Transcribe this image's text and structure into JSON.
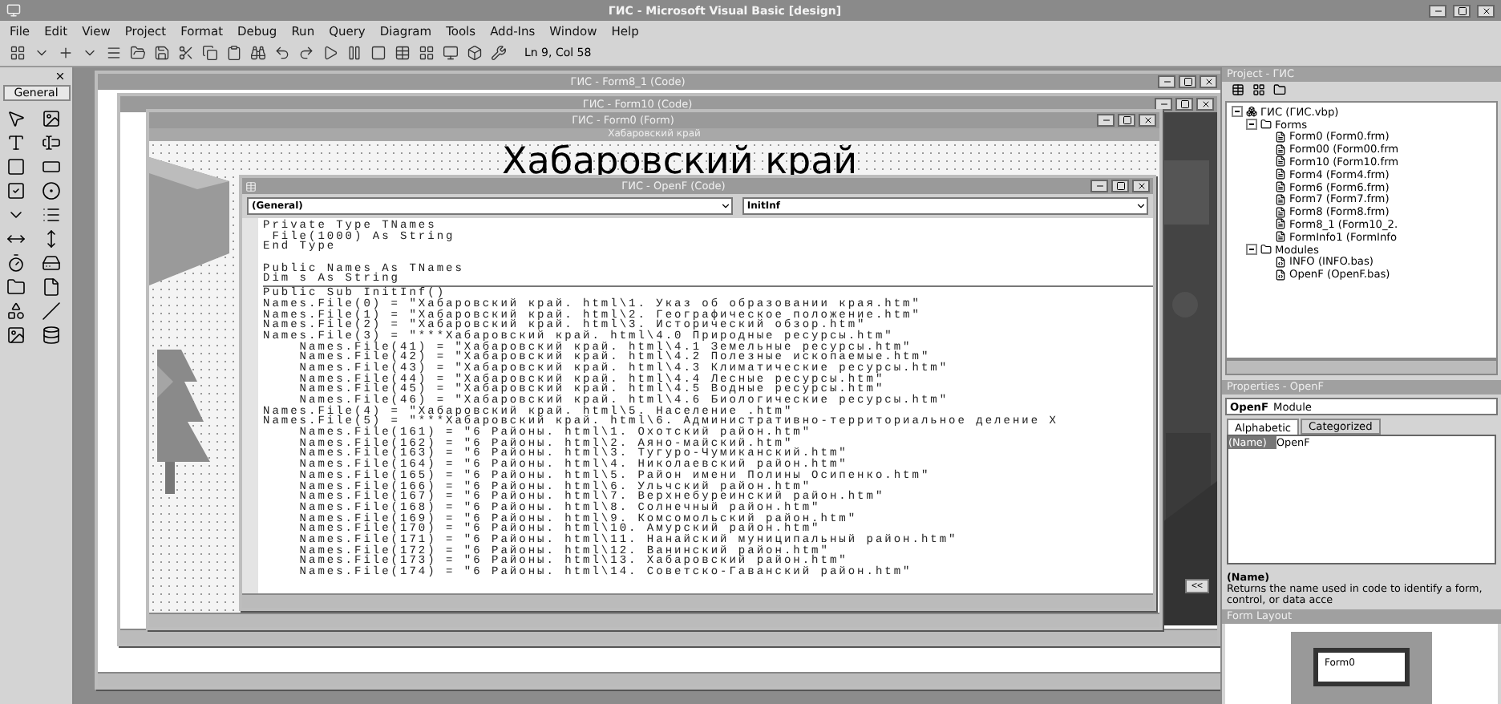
{
  "window": {
    "title": "ГИС - Microsoft Visual Basic [design]"
  },
  "menu": [
    "File",
    "Edit",
    "View",
    "Project",
    "Format",
    "Debug",
    "Run",
    "Query",
    "Diagram",
    "Tools",
    "Add-Ins",
    "Window",
    "Help"
  ],
  "cursor_position": "Ln 9, Col 58",
  "toolbox": {
    "tab": "General"
  },
  "mdi_windows": [
    {
      "title": "ГИС - Form8_1 (Code)"
    },
    {
      "title": "ГИС - Form10 (Code)"
    },
    {
      "title": "ГИС - Form0 (Form)",
      "form_caption": "Хабаровский край",
      "heading": "Хабаровский край"
    }
  ],
  "back_button": "<<",
  "code_window": {
    "title": "ГИС - OpenF (Code)",
    "object": "(General)",
    "procedure": "InitInf",
    "sections": [
      [
        [
          "Private Type TNames",
          " File(1000) As String",
          "End Type"
        ],
        [
          "Public Names As TNames",
          "Dim s As String"
        ]
      ],
      [
        [
          "Public Sub InitInf()",
          "Names.File(0) = \"Хабаровский край. html\\1. Указ об образовании края.htm\"",
          "Names.File(1) = \"Хабаровский край. html\\2. Географическое положение.htm\"",
          "Names.File(2) = \"Хабаровский край. html\\3. Исторический обзор.htm\"",
          "Names.File(3) = \"***Хабаровский край. html\\4.0 Природные ресурсы.htm\"",
          "    Names.File(41) = \"Хабаровский край. html\\4.1 Земельные ресурсы.htm\"",
          "    Names.File(42) = \"Хабаровский край. html\\4.2 Полезные ископаемые.htm\"",
          "    Names.File(43) = \"Хабаровский край. html\\4.3 Климатические ресурсы.htm\"",
          "    Names.File(44) = \"Хабаровский край. html\\4.4 Лесные ресурсы.htm\"",
          "    Names.File(45) = \"Хабаровский край. html\\4.5 Водные ресурсы.htm\"",
          "    Names.File(46) = \"Хабаровский край. html\\4.6 Биологические ресурсы.htm\"",
          "Names.File(4) = \"Хабаровский край. html\\5. Население .htm\"",
          "Names.File(5) = \"***Хабаровский край. html\\6. Административно-территориальное деление Х",
          "    Names.File(161) = \"6 Районы. html\\1. Охотский район.htm\"",
          "    Names.File(162) = \"6 Районы. html\\2. Аяно-майский.htm\"",
          "    Names.File(163) = \"6 Районы. html\\3. Тугуро-Чумиканский.htm\"",
          "    Names.File(164) = \"6 Районы. html\\4. Николаевский район.htm\"",
          "    Names.File(165) = \"6 Районы. html\\5. Район имени Полины Осипенко.htm\"",
          "    Names.File(166) = \"6 Районы. html\\6. Ульчский район.htm\"",
          "    Names.File(167) = \"6 Районы. html\\7. Верхнебуреинский район.htm\"",
          "    Names.File(168) = \"6 Районы. html\\8. Солнечный район.htm\"",
          "    Names.File(169) = \"6 Районы. html\\9. Комсомольский район.htm\"",
          "    Names.File(170) = \"6 Районы. html\\10. Амурский район.htm\"",
          "    Names.File(171) = \"6 Районы. html\\11. Нанайский муниципальный район.htm\"",
          "    Names.File(172) = \"6 Районы. html\\12. Ванинский район.htm\"",
          "    Names.File(173) = \"6 Районы. html\\13. Хабаровский район.htm\"",
          "    Names.File(174) = \"6 Районы. html\\14. Советско-Гаванский район.htm\""
        ]
      ]
    ]
  },
  "project": {
    "title": "Project - ГИС",
    "tree": [
      {
        "label": "ГИС (ГИС.vbp)",
        "kind": "project",
        "expanded": true,
        "children": [
          {
            "label": "Forms",
            "kind": "folder",
            "expanded": true,
            "children": [
              {
                "label": "Form0 (Form0.frm)",
                "kind": "form"
              },
              {
                "label": "Form00 (Form00.frm",
                "kind": "form"
              },
              {
                "label": "Form10 (Form10.frm",
                "kind": "form"
              },
              {
                "label": "Form4 (Form4.frm)",
                "kind": "form"
              },
              {
                "label": "Form6 (Form6.frm)",
                "kind": "form"
              },
              {
                "label": "Form7 (Form7.frm)",
                "kind": "form"
              },
              {
                "label": "Form8 (Form8.frm)",
                "kind": "form"
              },
              {
                "label": "Form8_1 (Form10_2.",
                "kind": "form"
              },
              {
                "label": "FormInfo1 (FormInfo",
                "kind": "form"
              }
            ]
          },
          {
            "label": "Modules",
            "kind": "folder",
            "expanded": true,
            "children": [
              {
                "label": "INFO (INFO.bas)",
                "kind": "module"
              },
              {
                "label": "OpenF (OpenF.bas)",
                "kind": "module"
              }
            ]
          }
        ]
      }
    ]
  },
  "properties": {
    "title": "Properties - OpenF",
    "object": "OpenF",
    "object_type": "Module",
    "tabs": [
      {
        "label": "Alphabetic",
        "selected": true
      },
      {
        "label": "Categorized",
        "selected": false
      }
    ],
    "rows": [
      {
        "name": "(Name)",
        "value": "OpenF",
        "selected": true
      }
    ],
    "description_title": "(Name)",
    "description": "Returns the name used in code to identify a form, control, or data acce"
  },
  "form_layout": {
    "title": "Form Layout",
    "form": "Form0"
  }
}
